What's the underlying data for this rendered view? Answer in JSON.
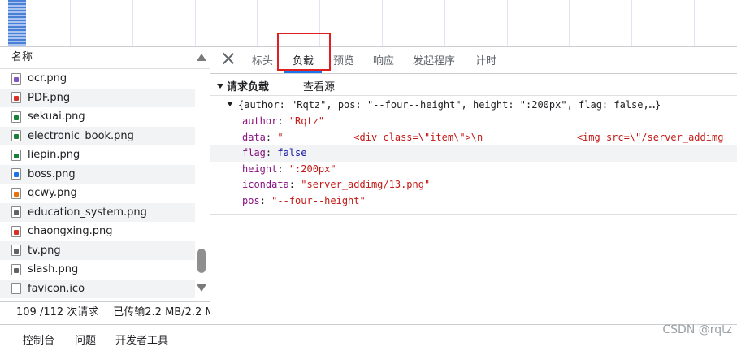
{
  "request_list": {
    "header": "名称",
    "items": [
      {
        "name": "ocr.png",
        "icon": "image-file-icon",
        "color": "#7e57c2"
      },
      {
        "name": "PDF.png",
        "icon": "image-file-icon",
        "color": "#d93025"
      },
      {
        "name": "sekuai.png",
        "icon": "image-file-icon",
        "color": "#188038"
      },
      {
        "name": "electronic_book.png",
        "icon": "image-file-icon",
        "color": "#188038"
      },
      {
        "name": "liepin.png",
        "icon": "image-file-icon",
        "color": "#188038"
      },
      {
        "name": "boss.png",
        "icon": "image-file-icon",
        "color": "#1a73e8"
      },
      {
        "name": "qcwy.png",
        "icon": "image-file-icon",
        "color": "#e8710a"
      },
      {
        "name": "education_system.png",
        "icon": "image-file-icon",
        "color": "#5f6368"
      },
      {
        "name": "chaongxing.png",
        "icon": "image-file-icon",
        "color": "#d93025"
      },
      {
        "name": "tv.png",
        "icon": "image-file-icon",
        "color": "#5f6368"
      },
      {
        "name": "slash.png",
        "icon": "image-file-icon",
        "color": "#5f6368"
      },
      {
        "name": "favicon.ico",
        "icon": "file-icon",
        "color": "#ffffff"
      }
    ],
    "status_requests": "109 /112 次请求",
    "status_transferred": "已传输2.2 MB/2.2 M"
  },
  "tabs": [
    {
      "label": "标头"
    },
    {
      "label": "负载"
    },
    {
      "label": "预览"
    },
    {
      "label": "响应"
    },
    {
      "label": "发起程序"
    },
    {
      "label": "计时"
    }
  ],
  "payload": {
    "section_title": "请求负载",
    "view_source": "查看源",
    "summary": "{author: \"Rqtz\", pos: \"--four--height\", height: \":200px\", flag: false,…}",
    "fields": [
      {
        "key": "author",
        "value": "\"Rqtz\"",
        "kind": "string"
      },
      {
        "key": "data",
        "value": "\"            <div class=\\\"item\\\">\\n                <img src=\\\"/server_addimg",
        "kind": "string"
      },
      {
        "key": "flag",
        "value": "false",
        "kind": "bool"
      },
      {
        "key": "height",
        "value": "\":200px\"",
        "kind": "string"
      },
      {
        "key": "icondata",
        "value": "\"server_addimg/13.png\"",
        "kind": "string"
      },
      {
        "key": "pos",
        "value": "\"--four--height\"",
        "kind": "string"
      }
    ]
  },
  "drawer": {
    "tab1": "控制台",
    "tab2": "问题",
    "tab3": "开发者工具"
  },
  "watermark": "CSDN @rqtz"
}
